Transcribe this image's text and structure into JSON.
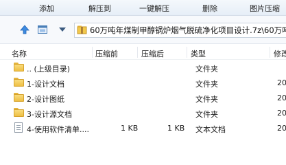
{
  "toolbar": {
    "buttons": [
      "添加",
      "解压到",
      "一键解压",
      "删除",
      "图片压缩"
    ]
  },
  "address": {
    "path": "60万吨年煤制甲醇锅炉烟气脱硫净化项目设计.7z\\60万吨"
  },
  "columns": [
    "名称",
    "压缩前",
    "压缩后",
    "类型",
    "修改"
  ],
  "files": [
    {
      "name": ".. (上级目录)",
      "before": "",
      "after": "",
      "type": "文件夹",
      "modified": "",
      "icon": "folder-icon"
    },
    {
      "name": "1-设计文档",
      "before": "",
      "after": "",
      "type": "文件夹",
      "modified": "20",
      "icon": "folder-icon"
    },
    {
      "name": "2-设计图纸",
      "before": "",
      "after": "",
      "type": "文件夹",
      "modified": "20",
      "icon": "folder-icon"
    },
    {
      "name": "3-设计源文档",
      "before": "",
      "after": "",
      "type": "文件夹",
      "modified": "20",
      "icon": "folder-icon"
    },
    {
      "name": "4-使用软件清单....",
      "before": "1 KB",
      "after": "1 KB",
      "type": "文本文档",
      "modified": "20",
      "icon": "text-file-icon"
    }
  ],
  "colors": {
    "accent": "#2b7bd6",
    "folder": "#f3c74f"
  }
}
